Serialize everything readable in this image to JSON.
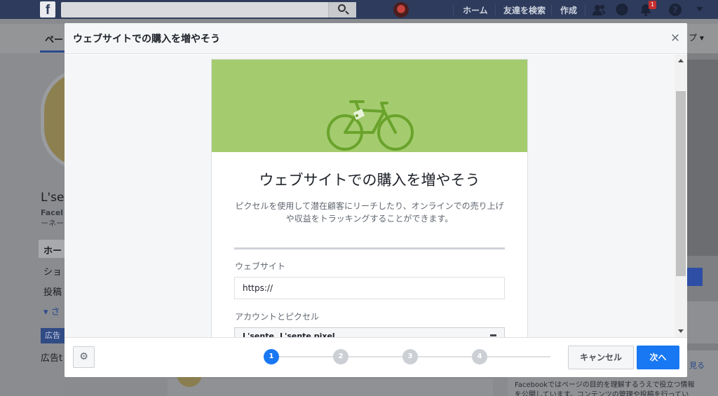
{
  "topbar": {
    "logo": "f",
    "nav": [
      "ホーム",
      "友達を検索",
      "作成"
    ],
    "notification_count": "1",
    "help": "?"
  },
  "background": {
    "tab_label": "ペー",
    "tab_right": "プ ▾",
    "page_name": "L'se",
    "page_sub1": "Facel",
    "page_sub2": "ーネー",
    "menu": [
      "ホー",
      "ショ",
      "投稿",
      "▾ さ"
    ],
    "promote": "広告",
    "promote_text": "広告t",
    "right_link": "見る",
    "bottom_text1": "Facebookではページの目的を理解するうえで役立つ情報",
    "bottom_text2": "を公開しています。コンテンツの管理や投稿を行ってい"
  },
  "modal": {
    "title": "ウェブサイトでの購入を増やそう",
    "close": "×",
    "card": {
      "heading": "ウェブサイトでの購入を増やそう",
      "description": "ピクセルを使用して潜在顧客にリーチしたり、オンラインでの売り上げや収益をトラッキングすることができます。",
      "website_label": "ウェブサイト",
      "website_value": "https://",
      "account_label": "アカウントとピクセル",
      "account_value": "L'sente, L'sente pixel"
    },
    "steps": [
      "1",
      "2",
      "3",
      "4"
    ],
    "active_step": 1,
    "cancel_label": "キャンセル",
    "next_label": "次へ",
    "colors": {
      "hero": "#a4cc6f",
      "bike": "#6aa32c",
      "accent": "#1877f2"
    }
  }
}
